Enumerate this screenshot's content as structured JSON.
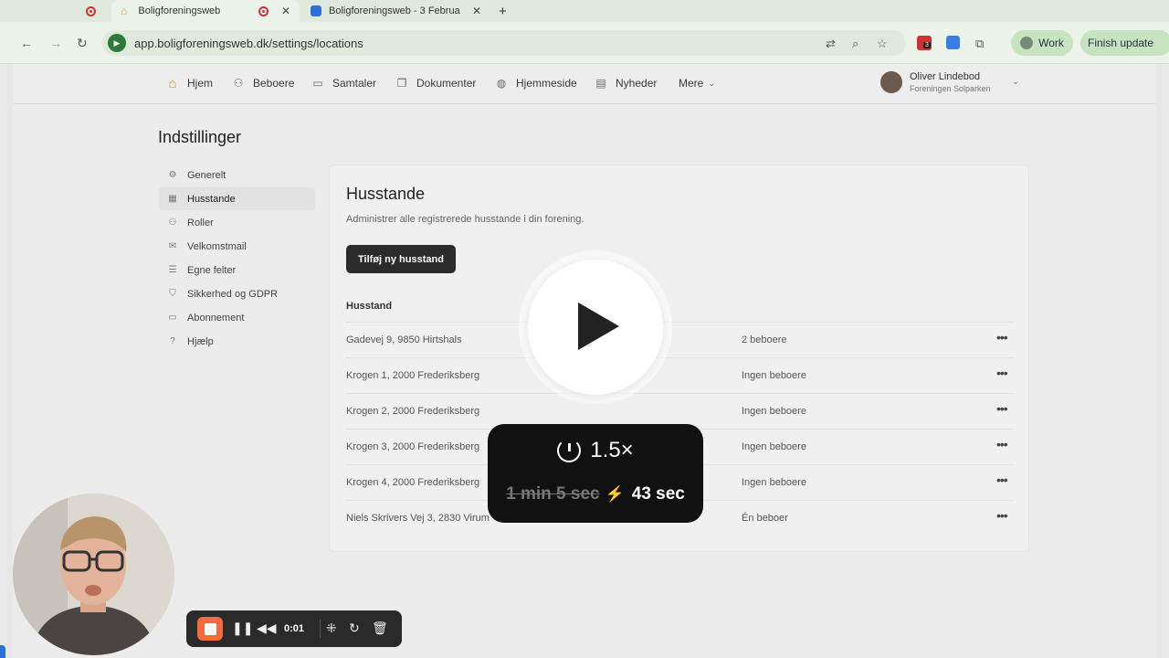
{
  "browser": {
    "tabs": [
      {
        "label": "Boligforeningsweb",
        "active": true
      },
      {
        "label": "Boligforeningsweb - 3 Februa",
        "active": false
      }
    ],
    "new_tab": "+",
    "url": "app.boligforeningsweb.dk/settings/locations",
    "profile_label": "Work",
    "update_label": "Finish update",
    "extension_badge": "3"
  },
  "app_nav": {
    "items": [
      {
        "label": "Hjem",
        "icon": "home-icon"
      },
      {
        "label": "Beboere",
        "icon": "users-icon"
      },
      {
        "label": "Samtaler",
        "icon": "chat-icon"
      },
      {
        "label": "Dokumenter",
        "icon": "documents-icon"
      },
      {
        "label": "Hjemmeside",
        "icon": "globe-icon"
      },
      {
        "label": "Nyheder",
        "icon": "news-icon"
      },
      {
        "label": "Mere",
        "icon": "chevron-down-icon"
      }
    ],
    "user": {
      "name": "Oliver Lindebod",
      "org": "Foreningen Solparken"
    }
  },
  "settings": {
    "title": "Indstillinger",
    "sidebar": [
      {
        "label": "Generelt",
        "icon": "gear-icon",
        "active": false
      },
      {
        "label": "Husstande",
        "icon": "building-icon",
        "active": true
      },
      {
        "label": "Roller",
        "icon": "roles-icon",
        "active": false
      },
      {
        "label": "Velkomstmail",
        "icon": "mail-icon",
        "active": false
      },
      {
        "label": "Egne felter",
        "icon": "fields-icon",
        "active": false
      },
      {
        "label": "Sikkerhed og GDPR",
        "icon": "shield-icon",
        "active": false
      },
      {
        "label": "Abonnement",
        "icon": "card-icon",
        "active": false
      },
      {
        "label": "Hjælp",
        "icon": "help-icon",
        "active": false
      }
    ]
  },
  "households": {
    "title": "Husstande",
    "subtitle": "Administrer alle registrerede husstande i din forening.",
    "add_button": "Tilføj ny husstand",
    "column_header": "Husstand",
    "rows": [
      {
        "address": "Gadevej 9, 9850 Hirtshals",
        "residents": "2 beboere"
      },
      {
        "address": "Krogen 1, 2000 Frederiksberg",
        "residents": "Ingen beboere"
      },
      {
        "address": "Krogen 2, 2000 Frederiksberg",
        "residents": "Ingen beboere"
      },
      {
        "address": "Krogen 3, 2000 Frederiksberg",
        "residents": "Ingen beboere"
      },
      {
        "address": "Krogen 4, 2000 Frederiksberg",
        "residents": "Ingen beboere"
      },
      {
        "address": "Niels Skrivers Vej 3, 2830 Virum",
        "residents": "Én beboer"
      }
    ],
    "row_menu": "•••"
  },
  "overlay": {
    "speed": "1.5×",
    "original_time": "1 min 5 sec",
    "new_time": "43 sec"
  },
  "recorder": {
    "elapsed": "0:01"
  }
}
